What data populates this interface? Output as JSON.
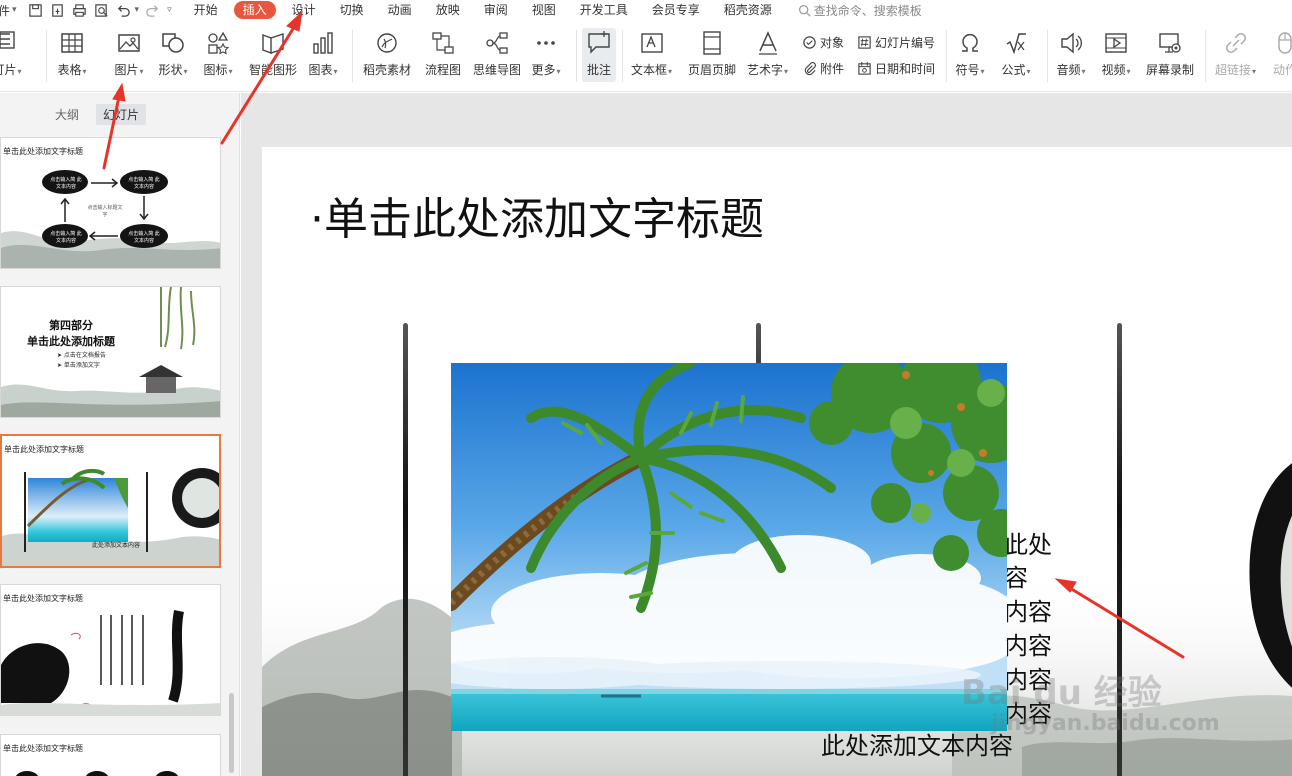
{
  "menubar": {
    "file_label": "件",
    "tabs": [
      "开始",
      "插入",
      "设计",
      "切换",
      "动画",
      "放映",
      "审阅",
      "视图",
      "开发工具",
      "会员专享",
      "稻壳资源"
    ],
    "active_tab": "插入",
    "search_placeholder": "查找命令、搜索模板"
  },
  "ribbon": {
    "slides_label": "灯片",
    "table": "表格",
    "picture": "图片",
    "shape": "形状",
    "icon": "图标",
    "smart": "智能图形",
    "chart": "图表",
    "docer": "稻壳素材",
    "flow": "流程图",
    "mind": "思维导图",
    "more": "更多",
    "comment": "批注",
    "textbox": "文本框",
    "header": "页眉页脚",
    "arttext": "艺术字",
    "object": "对象",
    "attach": "附件",
    "slide_number": "幻灯片编号",
    "datetime": "日期和时间",
    "symbol": "符号",
    "formula": "公式",
    "audio": "音频",
    "video": "视频",
    "screenrec": "屏幕录制",
    "hyperlink": "超链接",
    "action": "动作"
  },
  "panel": {
    "tab_outline": "大纲",
    "tab_slides": "幻灯片"
  },
  "thumbs": {
    "t1_title": "单击此处添加文字标题",
    "t1_box1": "点击输入简 此文本内容",
    "t1_box2": "点击输入简 此文本内容",
    "t1_box3": "点击输入简 此文本内容",
    "t1_box4": "点击输入简 此文本内容",
    "t1_center": "点击输入标题文 字",
    "t2_part": "第四部分",
    "t2_title": "单击此处添加标题",
    "t2_b1": "➤  点击在文档报告",
    "t2_b2": "➤  单击添加文字",
    "t3_title": "单击此处添加文字标题",
    "t3_bottom": "此处添加文本内容",
    "t4_title": "单击此处添加文字标题",
    "t5_title": "单击此处添加文字标题"
  },
  "slide": {
    "title": "·单击此处添加文字标题",
    "side_lines": [
      "此处",
      "容",
      "内容",
      "内容",
      "内容",
      "内容"
    ],
    "bottom_line": "此处添加文本内容"
  },
  "watermark": {
    "logo_text": "Bai du 经验",
    "url": "jingyan.baidu.com"
  },
  "colors": {
    "accent": "#e8563f",
    "arrow": "#e8332a",
    "current_thumb": "#e8793e"
  }
}
